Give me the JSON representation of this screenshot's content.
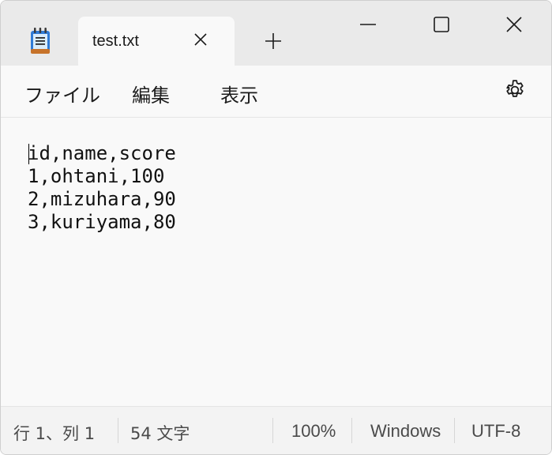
{
  "tab": {
    "title": "test.txt"
  },
  "menu": {
    "file": "ファイル",
    "edit": "編集",
    "view": "表示"
  },
  "editor": {
    "content": "id,name,score\n1,ohtani,100\n2,mizuhara,90\n3,kuriyama,80"
  },
  "status": {
    "position": "行 1、列 1",
    "characters": "54 文字",
    "zoom": "100%",
    "line_ending": "Windows",
    "encoding": "UTF-8"
  },
  "icons": {
    "app": "notepad-icon",
    "tab_close": "close-icon",
    "new_tab": "plus-icon",
    "minimize": "minimize-icon",
    "maximize": "maximize-icon",
    "close": "close-icon",
    "settings": "gear-icon"
  },
  "colors": {
    "titlebar": "#eaeaea",
    "background": "#f9f9f9",
    "accent": "#2f7bd6"
  }
}
